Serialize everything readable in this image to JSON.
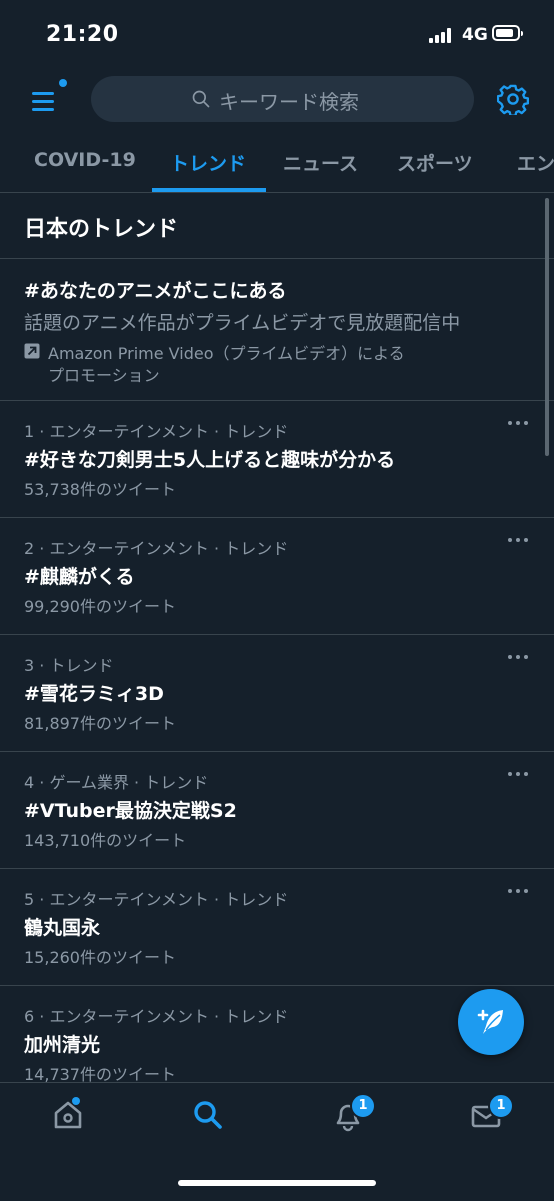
{
  "status_bar": {
    "time": "21:20",
    "network": "4G",
    "battery_level": 0.85
  },
  "header": {
    "search_placeholder": "キーワード検索"
  },
  "tabs": [
    {
      "label": "COVID-19",
      "active": false
    },
    {
      "label": "トレンド",
      "active": true
    },
    {
      "label": "ニュース",
      "active": false
    },
    {
      "label": "スポーツ",
      "active": false
    },
    {
      "label": "エン",
      "active": false
    }
  ],
  "section": {
    "title": "日本のトレンド"
  },
  "promo": {
    "title": "#あなたのアニメがここにある",
    "description": "話題のアニメ作品がプライムビデオで見放題配信中",
    "promoted_line1": "Amazon Prime Video（プライムビデオ）による",
    "promoted_line2": "プロモーション"
  },
  "trends": [
    {
      "meta": "1 · エンターテインメント · トレンド",
      "name": "#好きな刀剣男士5人上げると趣味が分かる",
      "count": "53,738件のツイート"
    },
    {
      "meta": "2 · エンターテインメント · トレンド",
      "name": "#麒麟がくる",
      "count": "99,290件のツイート"
    },
    {
      "meta": "3 · トレンド",
      "name": "#雪花ラミィ3D",
      "count": "81,897件のツイート"
    },
    {
      "meta": "4 · ゲーム業界 · トレンド",
      "name": "#VTuber最協決定戦S2",
      "count": "143,710件のツイート"
    },
    {
      "meta": "5 · エンターテインメント · トレンド",
      "name": "鶴丸国永",
      "count": "15,260件のツイート"
    },
    {
      "meta": "6 · エンターテインメント · トレンド",
      "name": "加州清光",
      "count": "14,737件のツイート"
    }
  ],
  "bottom_nav": {
    "items": [
      {
        "icon": "home-icon",
        "badge": ""
      },
      {
        "icon": "search-icon",
        "badge": ""
      },
      {
        "icon": "bell-icon",
        "badge": "1"
      },
      {
        "icon": "mail-icon",
        "badge": "1"
      }
    ]
  },
  "colors": {
    "background": "#15202b",
    "accent": "#1d9bf0",
    "secondary_text": "#8b98a5",
    "divider": "#38444d"
  }
}
